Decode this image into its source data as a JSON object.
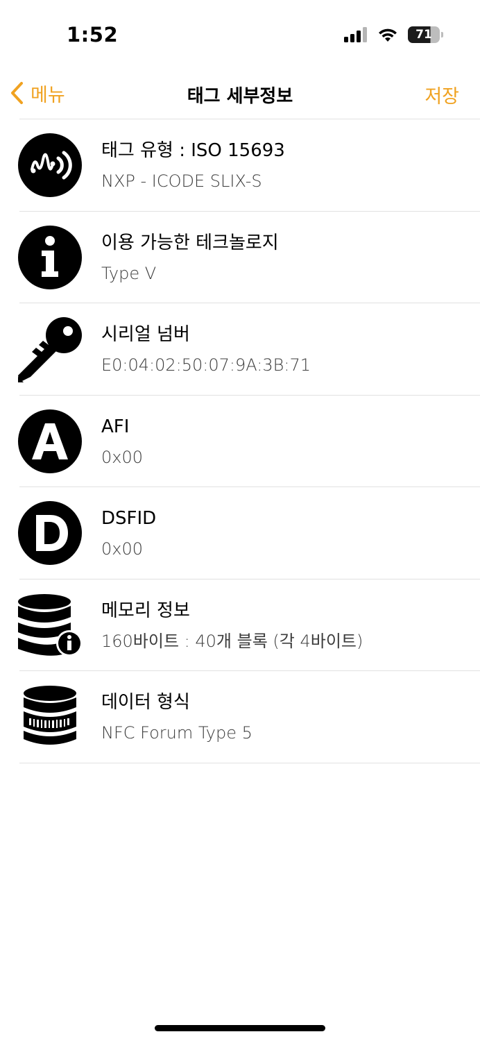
{
  "status_bar": {
    "time": "1:52",
    "battery": "71"
  },
  "nav": {
    "back_label": "메뉴",
    "title": "태그 세부정보",
    "save_label": "저장",
    "accent_color": "#f0a221"
  },
  "rows": [
    {
      "icon": "nfc-tag-icon",
      "title": "태그 유형 : ISO 15693",
      "subtitle": "NXP - ICODE SLIX-S"
    },
    {
      "icon": "info-icon",
      "title": "이용 가능한 테크놀로지",
      "subtitle": "Type V"
    },
    {
      "icon": "key-icon",
      "title": "시리얼 넘버",
      "subtitle": "E0:04:02:50:07:9A:3B:71"
    },
    {
      "icon": "letter-a-icon",
      "title": "AFI",
      "subtitle": "0x00"
    },
    {
      "icon": "letter-d-icon",
      "title": "DSFID",
      "subtitle": "0x00"
    },
    {
      "icon": "database-info-icon",
      "title": "메모리 정보",
      "subtitle": "160바이트 : 40개 블록 (각 4바이트)"
    },
    {
      "icon": "database-icon",
      "title": "데이터 형식",
      "subtitle": "NFC Forum Type 5"
    }
  ]
}
